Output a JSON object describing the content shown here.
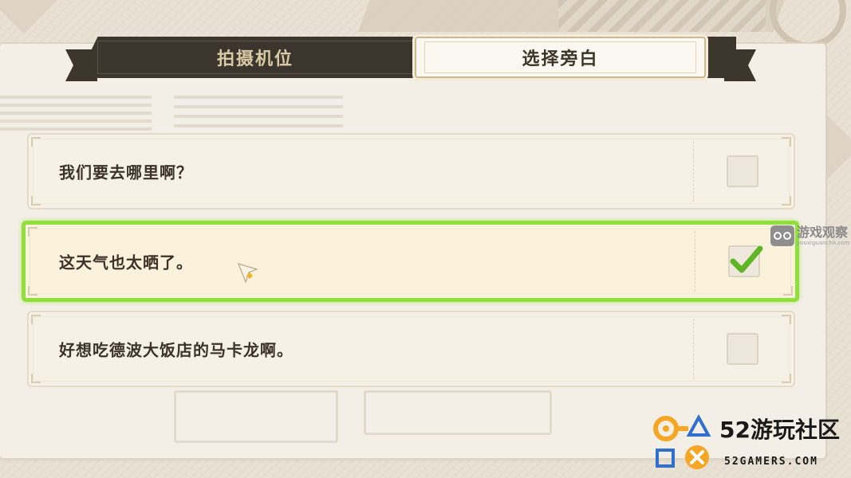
{
  "tabs": {
    "camera": "拍摄机位",
    "narration": "选择旁白"
  },
  "options": [
    {
      "text": "我们要去哪里啊？",
      "checked": false
    },
    {
      "text": "这天气也太晒了。",
      "checked": true
    },
    {
      "text": "好想吃德波大饭店的马卡龙啊。",
      "checked": false
    }
  ],
  "watermark1": {
    "title": "游戏观察",
    "subtitle": "youxiguancha.com"
  },
  "watermark2": {
    "title": "52游玩社区",
    "url": "52GAMERS.COM"
  },
  "colors": {
    "selected_border": "#8fe03a",
    "check": "#5fb524",
    "tab_dark": "#3b352d",
    "logo_orange": "#f5a623",
    "logo_blue": "#2f6fcf"
  }
}
